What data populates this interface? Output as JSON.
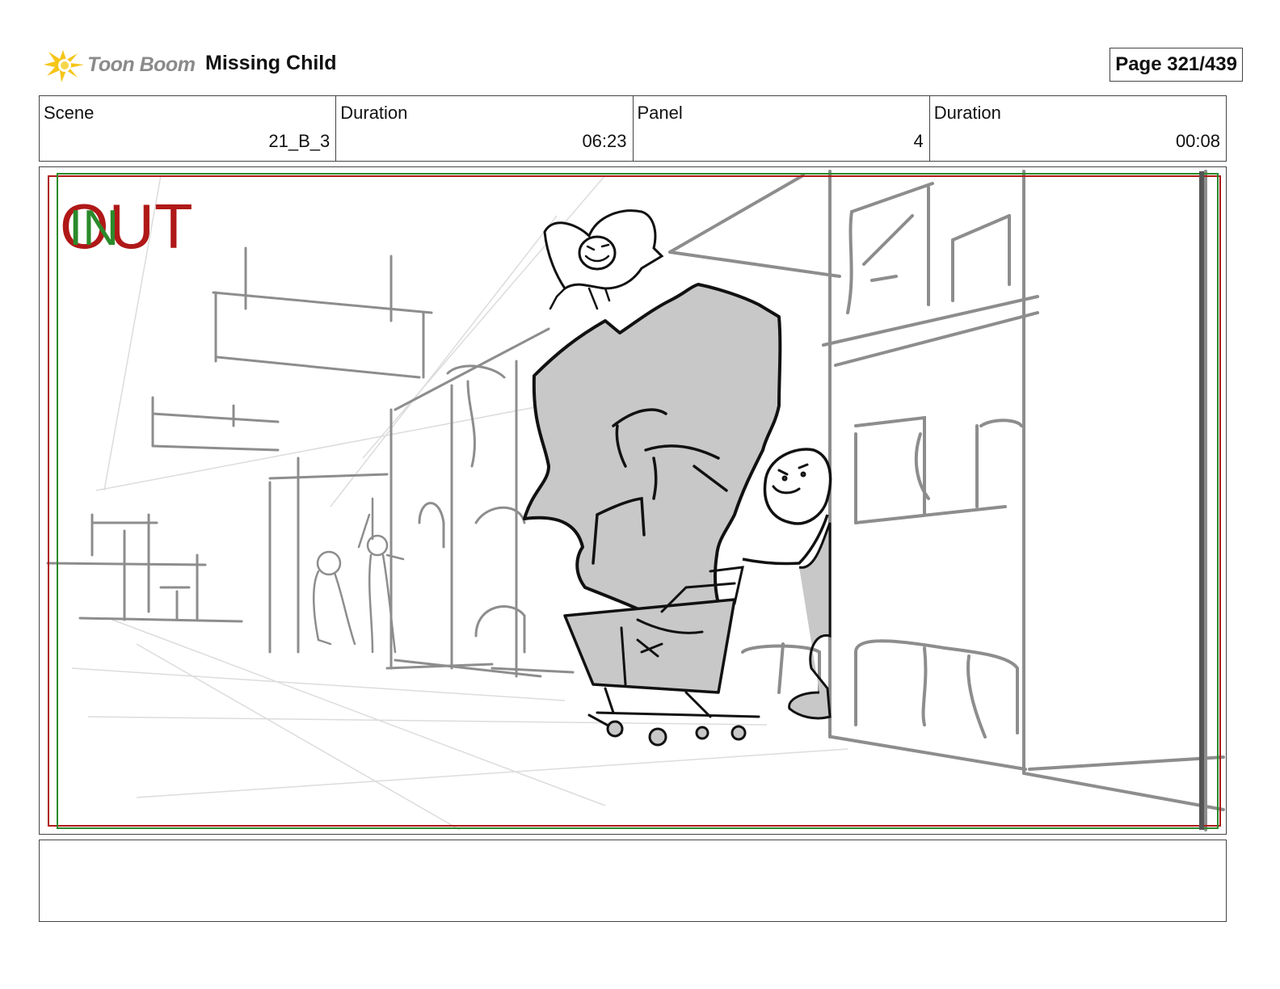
{
  "header": {
    "logo_text": "Toon Boom",
    "project_title": "Missing Child",
    "page_label": "Page 321/439"
  },
  "info": {
    "scene_label": "Scene",
    "scene_value": "21_B_3",
    "scene_duration_label": "Duration",
    "scene_duration_value": "06:23",
    "panel_label": "Panel",
    "panel_value": "4",
    "panel_duration_label": "Duration",
    "panel_duration_value": "00:08"
  },
  "panel_frame": {
    "in_label": "IN",
    "out_label": "OUT",
    "in_color": "#2a8a2a",
    "out_color": "#b01818"
  },
  "notes": {
    "text": ""
  }
}
